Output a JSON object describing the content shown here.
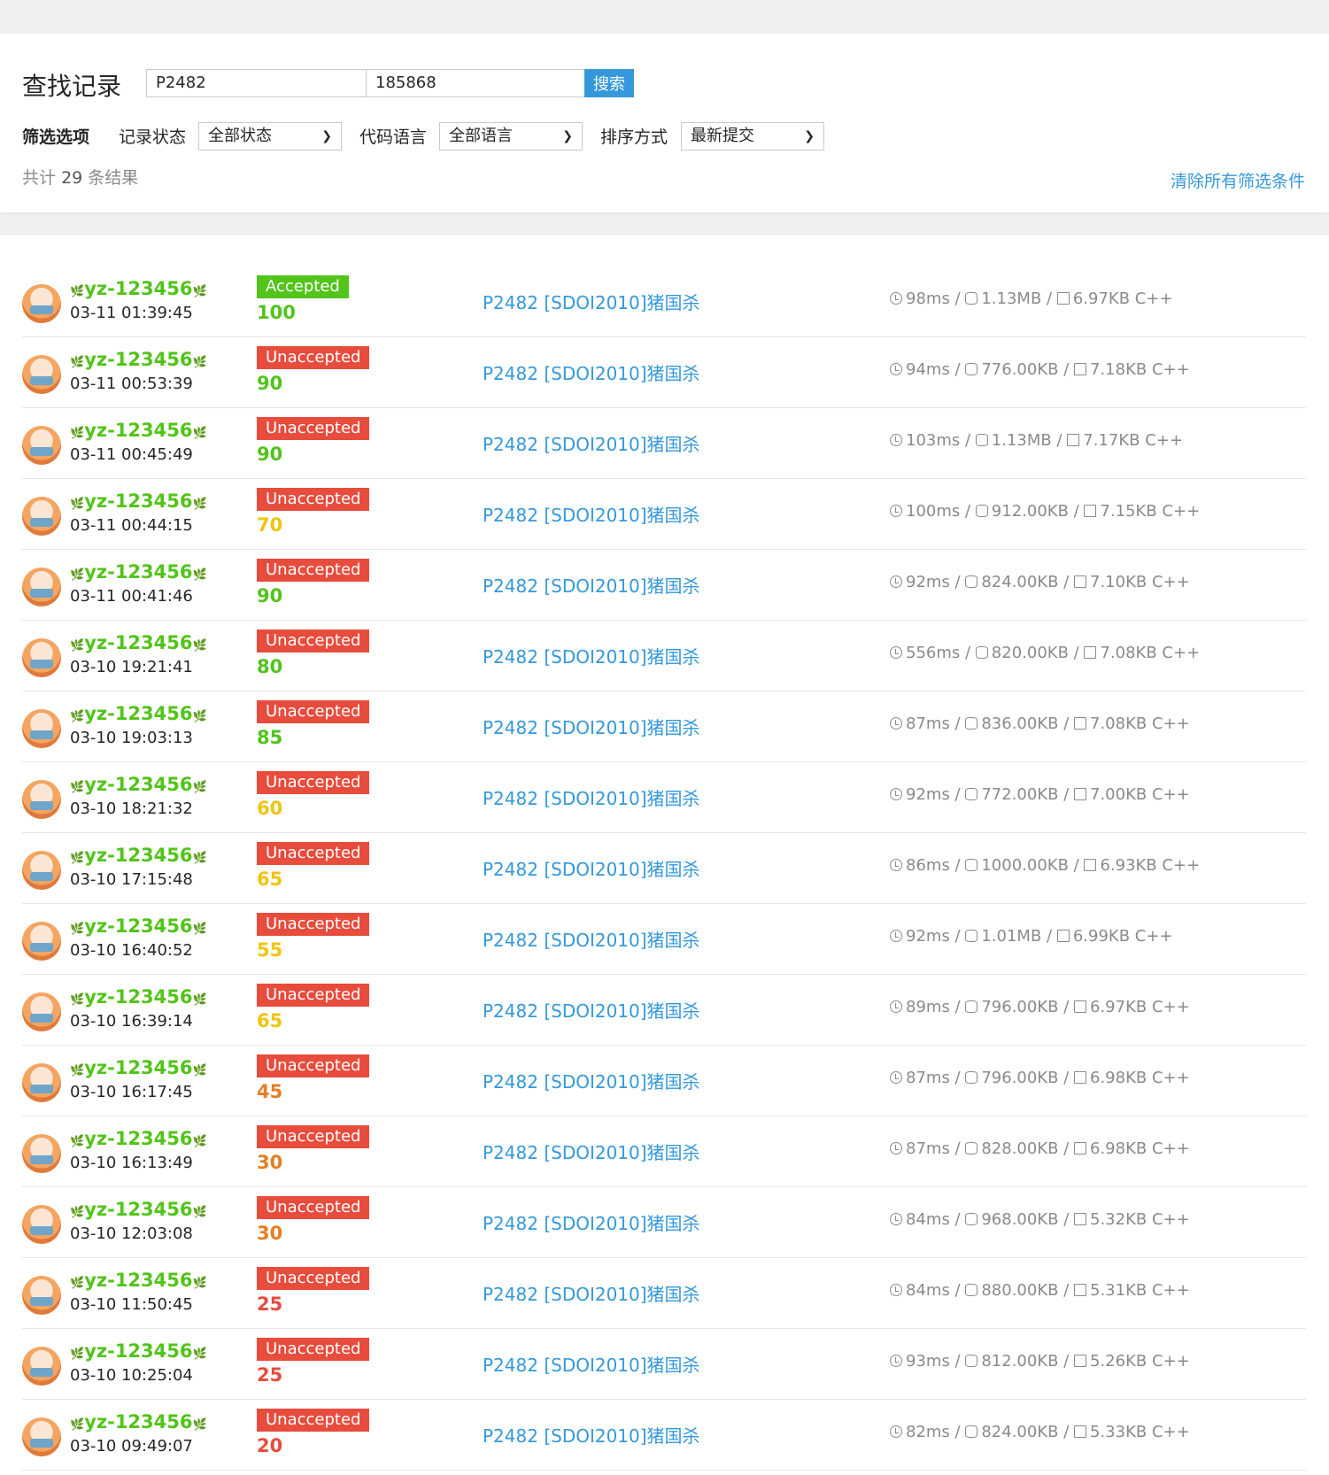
{
  "search": {
    "title": "查找记录",
    "problem_value": "P2482",
    "user_value": "185868",
    "button_label": "搜索"
  },
  "filters": {
    "section_label": "筛选选项",
    "status_label": "记录状态",
    "status_value": "全部状态",
    "language_label": "代码语言",
    "language_value": "全部语言",
    "sort_label": "排序方式",
    "sort_value": "最新提交"
  },
  "summary": {
    "prefix": "共计",
    "count": "29",
    "suffix": "条结果",
    "clear_label": "清除所有筛选条件"
  },
  "colors": {
    "accent": "#3498db",
    "accepted": "#52c41a",
    "unaccepted": "#e74c3c",
    "score_green": "#52c41a",
    "score_orange": "#e67e22",
    "score_yellow": "#f1c40f",
    "score_red": "#e74c3c"
  },
  "records": [
    {
      "user": "yz-123456",
      "time": "03-11 01:39:45",
      "status": "Accepted",
      "score": "100",
      "problem": "P2482 [SDOI2010]猪国杀",
      "runtime": "98ms",
      "memory": "1.13MB",
      "size": "6.97KB",
      "lang": "C++"
    },
    {
      "user": "yz-123456",
      "time": "03-11 00:53:39",
      "status": "Unaccepted",
      "score": "90",
      "problem": "P2482 [SDOI2010]猪国杀",
      "runtime": "94ms",
      "memory": "776.00KB",
      "size": "7.18KB",
      "lang": "C++"
    },
    {
      "user": "yz-123456",
      "time": "03-11 00:45:49",
      "status": "Unaccepted",
      "score": "90",
      "problem": "P2482 [SDOI2010]猪国杀",
      "runtime": "103ms",
      "memory": "1.13MB",
      "size": "7.17KB",
      "lang": "C++"
    },
    {
      "user": "yz-123456",
      "time": "03-11 00:44:15",
      "status": "Unaccepted",
      "score": "70",
      "problem": "P2482 [SDOI2010]猪国杀",
      "runtime": "100ms",
      "memory": "912.00KB",
      "size": "7.15KB",
      "lang": "C++"
    },
    {
      "user": "yz-123456",
      "time": "03-11 00:41:46",
      "status": "Unaccepted",
      "score": "90",
      "problem": "P2482 [SDOI2010]猪国杀",
      "runtime": "92ms",
      "memory": "824.00KB",
      "size": "7.10KB",
      "lang": "C++"
    },
    {
      "user": "yz-123456",
      "time": "03-10 19:21:41",
      "status": "Unaccepted",
      "score": "80",
      "problem": "P2482 [SDOI2010]猪国杀",
      "runtime": "556ms",
      "memory": "820.00KB",
      "size": "7.08KB",
      "lang": "C++"
    },
    {
      "user": "yz-123456",
      "time": "03-10 19:03:13",
      "status": "Unaccepted",
      "score": "85",
      "problem": "P2482 [SDOI2010]猪国杀",
      "runtime": "87ms",
      "memory": "836.00KB",
      "size": "7.08KB",
      "lang": "C++"
    },
    {
      "user": "yz-123456",
      "time": "03-10 18:21:32",
      "status": "Unaccepted",
      "score": "60",
      "problem": "P2482 [SDOI2010]猪国杀",
      "runtime": "92ms",
      "memory": "772.00KB",
      "size": "7.00KB",
      "lang": "C++"
    },
    {
      "user": "yz-123456",
      "time": "03-10 17:15:48",
      "status": "Unaccepted",
      "score": "65",
      "problem": "P2482 [SDOI2010]猪国杀",
      "runtime": "86ms",
      "memory": "1000.00KB",
      "size": "6.93KB",
      "lang": "C++"
    },
    {
      "user": "yz-123456",
      "time": "03-10 16:40:52",
      "status": "Unaccepted",
      "score": "55",
      "problem": "P2482 [SDOI2010]猪国杀",
      "runtime": "92ms",
      "memory": "1.01MB",
      "size": "6.99KB",
      "lang": "C++"
    },
    {
      "user": "yz-123456",
      "time": "03-10 16:39:14",
      "status": "Unaccepted",
      "score": "65",
      "problem": "P2482 [SDOI2010]猪国杀",
      "runtime": "89ms",
      "memory": "796.00KB",
      "size": "6.97KB",
      "lang": "C++"
    },
    {
      "user": "yz-123456",
      "time": "03-10 16:17:45",
      "status": "Unaccepted",
      "score": "45",
      "problem": "P2482 [SDOI2010]猪国杀",
      "runtime": "87ms",
      "memory": "796.00KB",
      "size": "6.98KB",
      "lang": "C++"
    },
    {
      "user": "yz-123456",
      "time": "03-10 16:13:49",
      "status": "Unaccepted",
      "score": "30",
      "problem": "P2482 [SDOI2010]猪国杀",
      "runtime": "87ms",
      "memory": "828.00KB",
      "size": "6.98KB",
      "lang": "C++"
    },
    {
      "user": "yz-123456",
      "time": "03-10 12:03:08",
      "status": "Unaccepted",
      "score": "30",
      "problem": "P2482 [SDOI2010]猪国杀",
      "runtime": "84ms",
      "memory": "968.00KB",
      "size": "5.32KB",
      "lang": "C++"
    },
    {
      "user": "yz-123456",
      "time": "03-10 11:50:45",
      "status": "Unaccepted",
      "score": "25",
      "problem": "P2482 [SDOI2010]猪国杀",
      "runtime": "84ms",
      "memory": "880.00KB",
      "size": "5.31KB",
      "lang": "C++"
    },
    {
      "user": "yz-123456",
      "time": "03-10 10:25:04",
      "status": "Unaccepted",
      "score": "25",
      "problem": "P2482 [SDOI2010]猪国杀",
      "runtime": "93ms",
      "memory": "812.00KB",
      "size": "5.26KB",
      "lang": "C++"
    },
    {
      "user": "yz-123456",
      "time": "03-10 09:49:07",
      "status": "Unaccepted",
      "score": "20",
      "problem": "P2482 [SDOI2010]猪国杀",
      "runtime": "82ms",
      "memory": "824.00KB",
      "size": "5.33KB",
      "lang": "C++"
    }
  ]
}
